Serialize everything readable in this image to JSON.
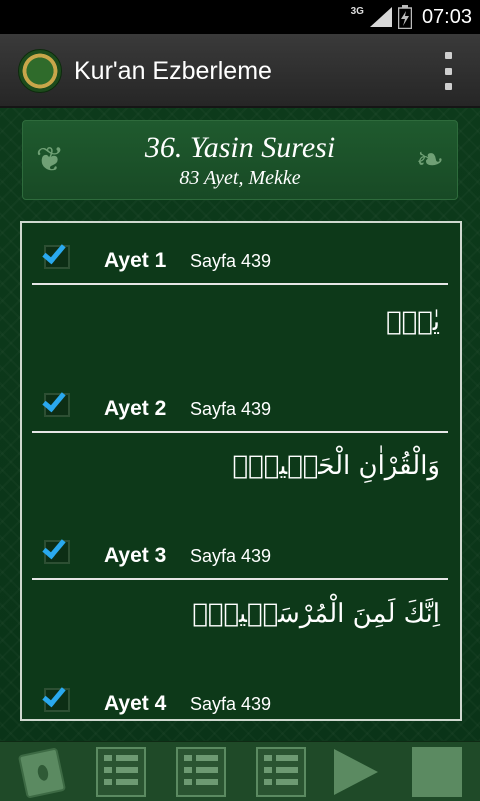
{
  "status_bar": {
    "network": "3G",
    "time": "07:03",
    "icons": [
      "signal-icon",
      "battery-icon"
    ]
  },
  "action_bar": {
    "title": "Kur'an Ezberleme",
    "logo_icon": "quran-logo-icon",
    "overflow_icon": "overflow-menu-icon"
  },
  "sura": {
    "title": "36. Yasin Suresi",
    "subtitle": "83 Ayet, Mekke"
  },
  "ayets": [
    {
      "label": "Ayet 1",
      "page": "Sayfa 439",
      "checked": true,
      "arabic": "يٰسٓۚ"
    },
    {
      "label": "Ayet 2",
      "page": "Sayfa 439",
      "checked": true,
      "arabic": "وَالْقُرْاٰنِ الْحَكٖيمِۙ"
    },
    {
      "label": "Ayet 3",
      "page": "Sayfa 439",
      "checked": true,
      "arabic": "اِنَّكَ لَمِنَ الْمُرْسَلٖينَۙ"
    },
    {
      "label": "Ayet 4",
      "page": "Sayfa 439",
      "checked": true,
      "arabic": ""
    }
  ],
  "toolbar": {
    "buttons": [
      "book-icon",
      "list-icon",
      "list-icon",
      "list-icon",
      "play-icon",
      "stop-icon"
    ]
  },
  "colors": {
    "background_green": "#0d3a1b",
    "checkbox_blue": "#2aa9ee",
    "action_bar": "#333333"
  }
}
